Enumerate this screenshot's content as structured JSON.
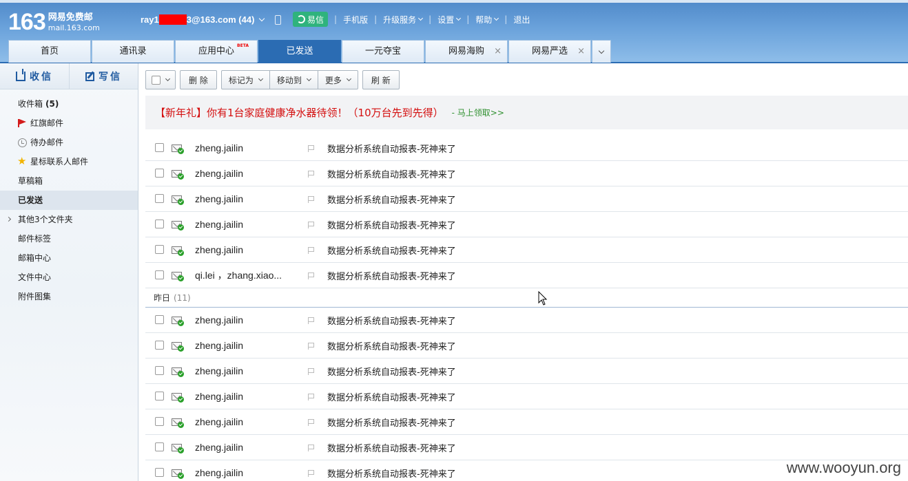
{
  "header": {
    "logo_number": "163",
    "logo_cn": "网易免费邮",
    "logo_en": "mail.163.com",
    "account_prefix": "ray1",
    "account_suffix": "3@163.com (44)",
    "yixin_label": "易信",
    "links": [
      "手机版",
      "升级服务",
      "设置",
      "帮助",
      "退出"
    ]
  },
  "tabs": [
    {
      "label": "首页"
    },
    {
      "label": "通讯录"
    },
    {
      "label": "应用中心",
      "badge": "BETA"
    },
    {
      "label": "已发送"
    },
    {
      "label": "一元夺宝"
    },
    {
      "label": "网易海购"
    },
    {
      "label": "网易严选"
    }
  ],
  "sidebar": {
    "receive_label": "收信",
    "write_label": "写信",
    "folders": [
      {
        "label": "收件箱",
        "count": "(5)"
      },
      {
        "label": "红旗邮件",
        "icon": "red-flag-icon"
      },
      {
        "label": "待办邮件",
        "icon": "clock-icon"
      },
      {
        "label": "星标联系人邮件",
        "icon": "star-icon"
      },
      {
        "label": "草稿箱"
      },
      {
        "label": "已发送"
      },
      {
        "label": "其他3个文件夹"
      },
      {
        "label": "邮件标签"
      },
      {
        "label": "邮箱中心"
      },
      {
        "label": "文件中心"
      },
      {
        "label": "附件图集"
      }
    ]
  },
  "toolbar": {
    "delete": "删 除",
    "mark_as": "标记为",
    "move_to": "移动到",
    "more": "更多",
    "refresh": "刷 新"
  },
  "promo": {
    "text": "【新年礼】你有1台家庭健康净水器待领！（10万台先到先得）",
    "link": "- 马上领取>>"
  },
  "mail": {
    "today": [
      {
        "sender": "zheng.jailin",
        "subject": "数据分析系统自动报表-死神来了"
      },
      {
        "sender": "zheng.jailin",
        "subject": "数据分析系统自动报表-死神来了"
      },
      {
        "sender": "zheng.jailin",
        "subject": "数据分析系统自动报表-死神来了"
      },
      {
        "sender": "zheng.jailin",
        "subject": "数据分析系统自动报表-死神来了"
      },
      {
        "sender": "zheng.jailin",
        "subject": "数据分析系统自动报表-死神来了"
      },
      {
        "sender": "qi.lei ，zhang.xiao...",
        "subject": "数据分析系统自动报表-死神来了"
      }
    ],
    "yesterday_label": "昨日",
    "yesterday_count": "(11)",
    "yesterday": [
      {
        "sender": "zheng.jailin",
        "subject": "数据分析系统自动报表-死神来了"
      },
      {
        "sender": "zheng.jailin",
        "subject": "数据分析系统自动报表-死神来了"
      },
      {
        "sender": "zheng.jailin",
        "subject": "数据分析系统自动报表-死神来了"
      },
      {
        "sender": "zheng.jailin",
        "subject": "数据分析系统自动报表-死神来了"
      },
      {
        "sender": "zheng.jailin",
        "subject": "数据分析系统自动报表-死神来了"
      },
      {
        "sender": "zheng.jailin",
        "subject": "数据分析系统自动报表-死神来了"
      },
      {
        "sender": "zheng.jailin",
        "subject": "数据分析系统自动报表-死神来了"
      }
    ]
  },
  "watermark": "www.wooyun.org",
  "colors": {
    "header_blue": "#4f89c9",
    "active_tab": "#2b6cb3",
    "promo_red": "#d40e0e",
    "promo_link_green": "#2d8f2d",
    "sent_check_green": "#2aa02a"
  }
}
